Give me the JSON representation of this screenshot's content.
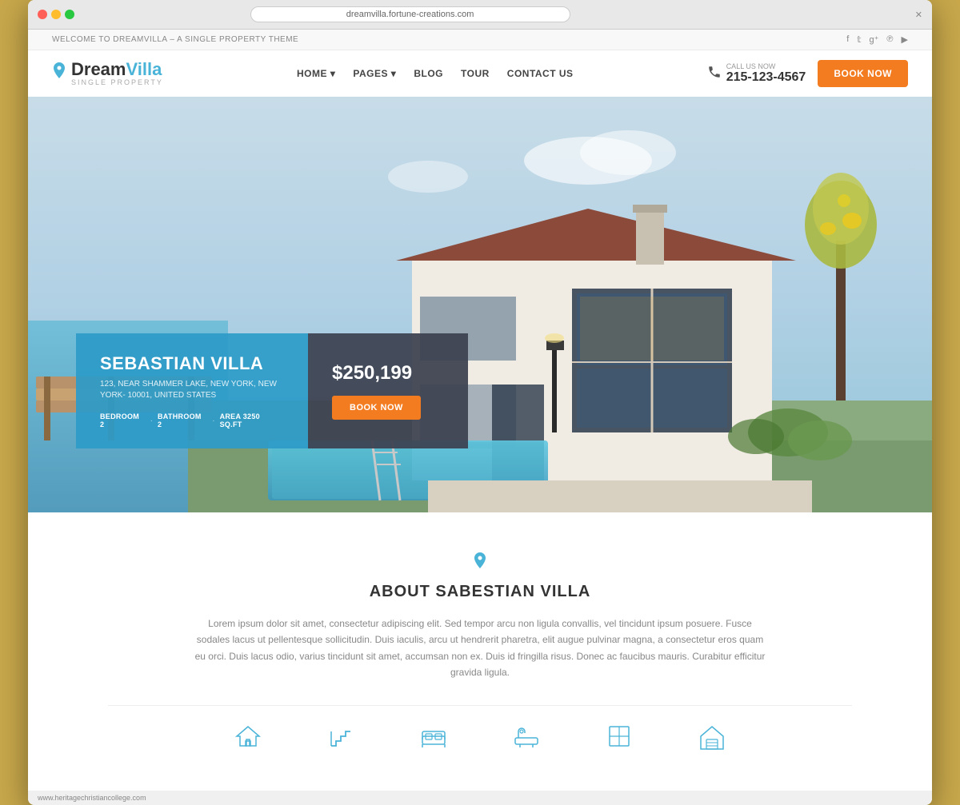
{
  "browser": {
    "url": "dreamvilla.fortune-creations.com",
    "close_btn": "✕",
    "new_tab": "+"
  },
  "topbar": {
    "welcome_text": "WELCOME TO DREAMVILLA – A SINGLE PROPERTY THEME",
    "social": [
      "f",
      "t",
      "g+",
      "p",
      "▶"
    ]
  },
  "nav": {
    "logo_main": "Dream",
    "logo_highlight": "Villa",
    "logo_sub": "SINGLE PROPERTY",
    "logo_icon": "📍",
    "links": [
      {
        "label": "HOME ▾",
        "has_dropdown": true
      },
      {
        "label": "PAGES ▾",
        "has_dropdown": true
      },
      {
        "label": "BLOG"
      },
      {
        "label": "TOUR"
      },
      {
        "label": "CONTACT US"
      }
    ],
    "call_label": "CALL US NOW",
    "call_number": "215-123-4567",
    "book_label": "BOOK NOW"
  },
  "hero": {
    "villa_name": "SEBASTIAN VILLA",
    "villa_address": "123, NEAR SHAMMER LAKE, NEW YORK, NEW YORK- 10001,\nUNITED STATES",
    "bedroom": "BEDROOM  2",
    "bathroom": "BATHROOM  2",
    "area": "AREA  3250 SQ.FT",
    "price": "$250,199",
    "book_label": "BOOK NOW"
  },
  "about": {
    "icon": "📍",
    "title": "ABOUT SABESTIAN VILLA",
    "text": "Lorem ipsum dolor sit amet, consectetur adipiscing elit. Sed tempor arcu non ligula convallis, vel tincidunt ipsum posuere. Fusce sodales lacus ut pellentesque sollicitudin. Duis iaculis, arcu ut hendrerit pharetra, elit augue pulvinar magna, a consectetur eros quam eu orci. Duis lacus odio, varius tincidunt sit amet, accumsan non ex. Duis id fringilla risus. Donec ac faucibus mauris. Curabitur efficitur gravida ligula.",
    "feature_icons": [
      {
        "name": "house-icon",
        "symbol": "⌂"
      },
      {
        "name": "stairs-icon",
        "symbol": "⇱"
      },
      {
        "name": "bed-icon",
        "symbol": "🛏"
      },
      {
        "name": "bath-icon",
        "symbol": "🛁"
      },
      {
        "name": "window-icon",
        "symbol": "▣"
      },
      {
        "name": "garage-icon",
        "symbol": "⌂"
      }
    ]
  },
  "footer": {
    "url": "www.heritagechristiancollege.com"
  },
  "colors": {
    "accent_blue": "#4ab3d8",
    "accent_orange": "#f47c20",
    "dark_panel": "#3c4150",
    "text_dark": "#333333",
    "text_light": "#888888"
  }
}
